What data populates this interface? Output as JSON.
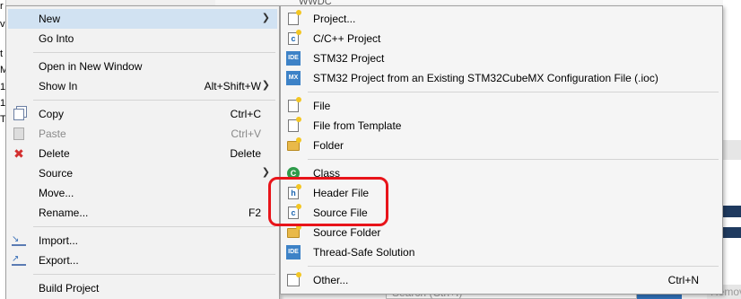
{
  "background": {
    "left_strip_chars": [
      "r",
      "v",
      "t",
      "M",
      "1",
      "1",
      "T"
    ],
    "top_tab": "WWDC",
    "search_placeholder": "Search (Ctrl+I)",
    "remove_label": "Remove"
  },
  "context_menu": {
    "items": [
      {
        "label": "New",
        "shortcut": "",
        "submenu": true,
        "icon": "",
        "highlighted": true
      },
      {
        "label": "Go Into",
        "shortcut": ""
      },
      {
        "label": "Open in New Window",
        "shortcut": ""
      },
      {
        "label": "Show In",
        "shortcut": "Alt+Shift+W",
        "submenu": true
      },
      {
        "label": "Copy",
        "shortcut": "Ctrl+C",
        "icon": "copy-icon"
      },
      {
        "label": "Paste",
        "shortcut": "Ctrl+V",
        "icon": "paste-icon",
        "disabled": true
      },
      {
        "label": "Delete",
        "shortcut": "Delete",
        "icon": "delete-icon"
      },
      {
        "label": "Source",
        "shortcut": "",
        "submenu": true
      },
      {
        "label": "Move...",
        "shortcut": ""
      },
      {
        "label": "Rename...",
        "shortcut": "F2"
      },
      {
        "label": "Import...",
        "shortcut": "",
        "icon": "import-icon"
      },
      {
        "label": "Export...",
        "shortcut": "",
        "icon": "export-icon"
      },
      {
        "label": "Build Project",
        "shortcut": ""
      }
    ]
  },
  "new_submenu": {
    "items": [
      {
        "label": "Project...",
        "icon": "project-wizard-icon"
      },
      {
        "label": "C/C++ Project",
        "icon": "cpp-project-icon"
      },
      {
        "label": "STM32 Project",
        "icon": "ide-icon"
      },
      {
        "label": "STM32 Project from an Existing STM32CubeMX Configuration File (.ioc)",
        "icon": "mx-icon"
      },
      {
        "label": "File",
        "icon": "file-icon"
      },
      {
        "label": "File from Template",
        "icon": "file-template-icon"
      },
      {
        "label": "Folder",
        "icon": "folder-icon"
      },
      {
        "label": "Class",
        "icon": "class-icon"
      },
      {
        "label": "Header File",
        "icon": "header-file-icon"
      },
      {
        "label": "Source File",
        "icon": "source-file-icon"
      },
      {
        "label": "Source Folder",
        "icon": "source-folder-icon"
      },
      {
        "label": "Thread-Safe Solution",
        "icon": "ide-icon"
      },
      {
        "label": "Other...",
        "shortcut": "Ctrl+N",
        "icon": "other-wizard-icon"
      }
    ],
    "ide_badge": "IDE",
    "mx_badge": "MX",
    "c_glyph": "c",
    "h_glyph": "h",
    "class_glyph": "C"
  },
  "colors": {
    "highlight_annotation": "#e8141a",
    "menu_hover": "#d1e2f2"
  }
}
